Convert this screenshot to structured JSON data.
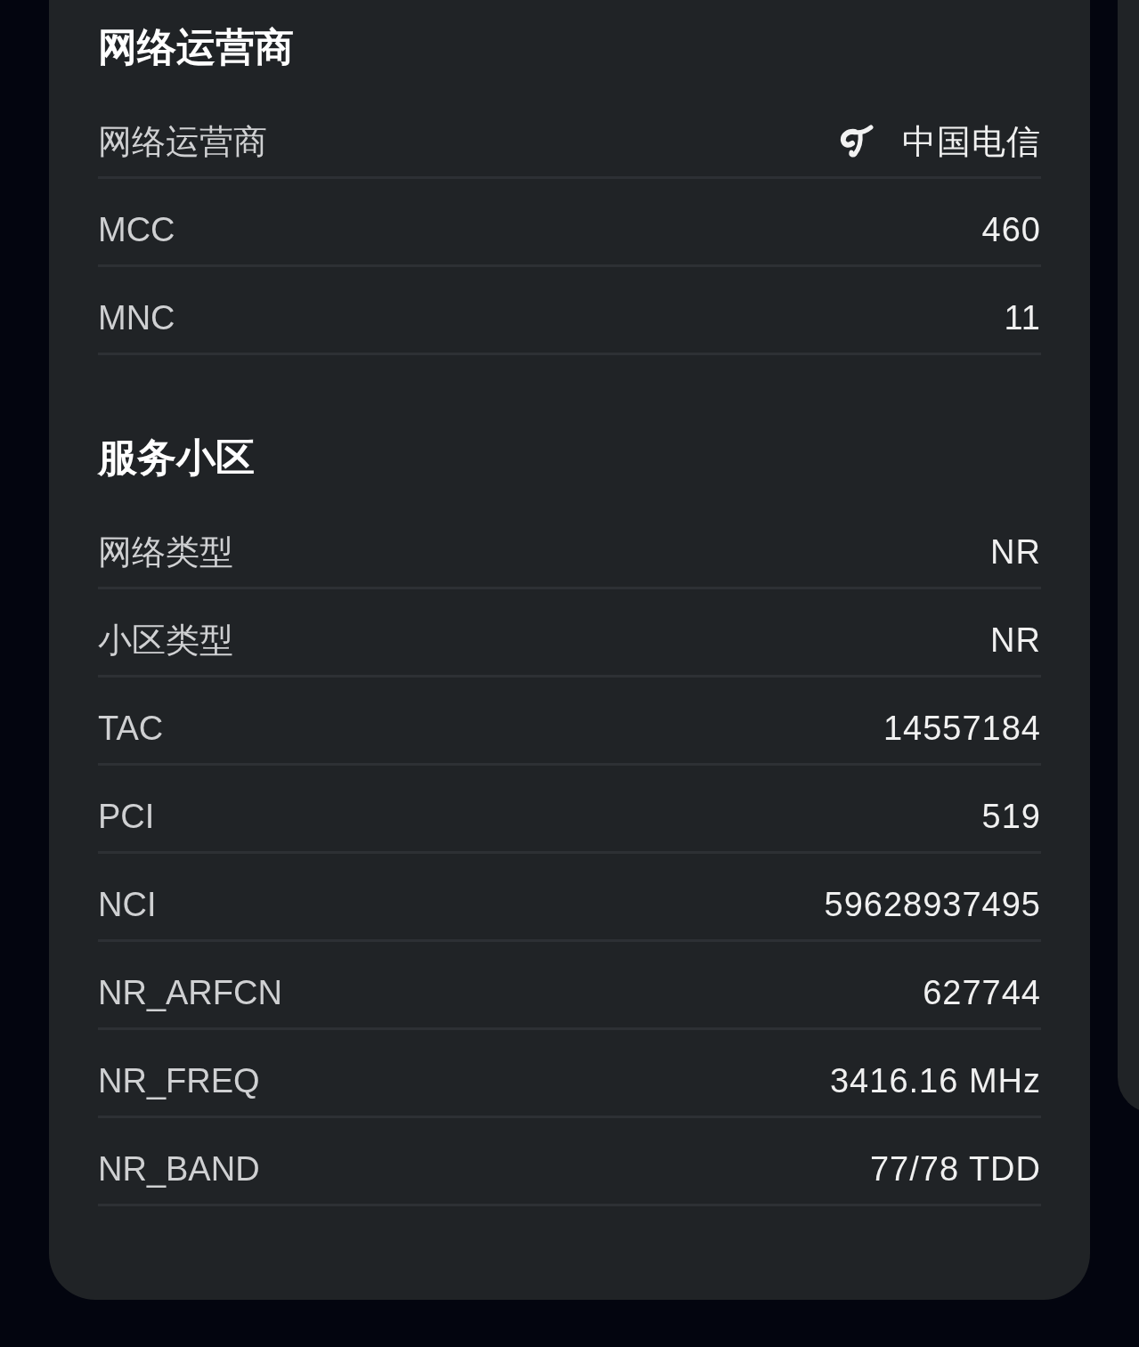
{
  "sections": [
    {
      "title": "网络运营商",
      "rows": [
        {
          "kind": "carrier",
          "label": "网络运营商",
          "value": "中国电信"
        },
        {
          "kind": "plain",
          "label": "MCC",
          "value": "460"
        },
        {
          "kind": "plain",
          "label": "MNC",
          "value": "11"
        }
      ]
    },
    {
      "title": "服务小区",
      "rows": [
        {
          "kind": "plain",
          "label": "网络类型",
          "value": "NR"
        },
        {
          "kind": "plain",
          "label": "小区类型",
          "value": "NR"
        },
        {
          "kind": "plain",
          "label": "TAC",
          "value": "14557184"
        },
        {
          "kind": "plain",
          "label": "PCI",
          "value": "519"
        },
        {
          "kind": "plain",
          "label": "NCI",
          "value": "59628937495"
        },
        {
          "kind": "plain",
          "label": "NR_ARFCN",
          "value": "627744"
        },
        {
          "kind": "plain",
          "label": "NR_FREQ",
          "value": "3416.16 MHz"
        },
        {
          "kind": "plain",
          "label": "NR_BAND",
          "value": "77/78 TDD"
        }
      ]
    }
  ]
}
